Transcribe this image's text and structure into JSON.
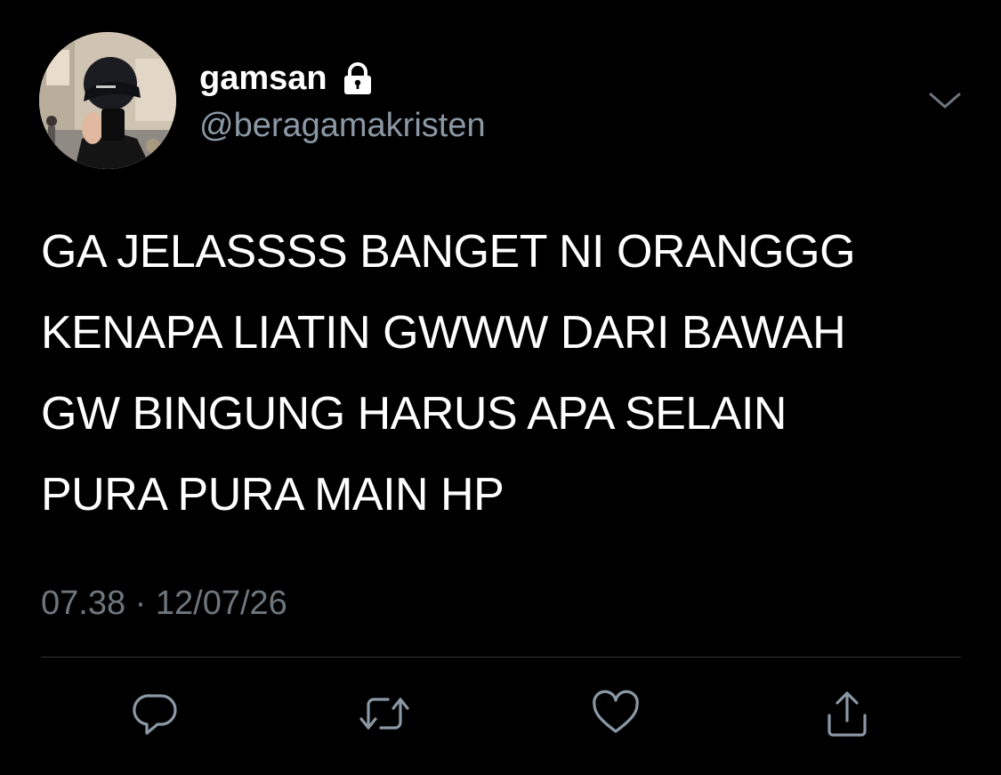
{
  "user": {
    "display_name": "gamsan",
    "handle": "@beragamakristen",
    "protected_icon": "lock-icon",
    "avatar": "avatar"
  },
  "menu": {
    "icon": "chevron-down-icon"
  },
  "tweet": {
    "lines": [
      "GA JELASSSS BANGET NI ORANGGG",
      "KENAPA LIATIN GWWW DARI BAWAH",
      "GW BINGUNG HARUS APA SELAIN",
      "PURA PURA MAIN HP"
    ],
    "time": "07.38",
    "separator": "·",
    "date": "12/07/26"
  },
  "actions": [
    {
      "name": "reply",
      "icon": "reply-icon"
    },
    {
      "name": "retweet",
      "icon": "retweet-icon"
    },
    {
      "name": "like",
      "icon": "heart-icon"
    },
    {
      "name": "share",
      "icon": "share-icon"
    }
  ],
  "colors": {
    "background": "#000000",
    "primary_text": "#ffffff",
    "secondary_text": "#8b98a5",
    "timestamp_text": "#6e767d",
    "icon": "#8b98a5",
    "divider": "#2f3336"
  }
}
